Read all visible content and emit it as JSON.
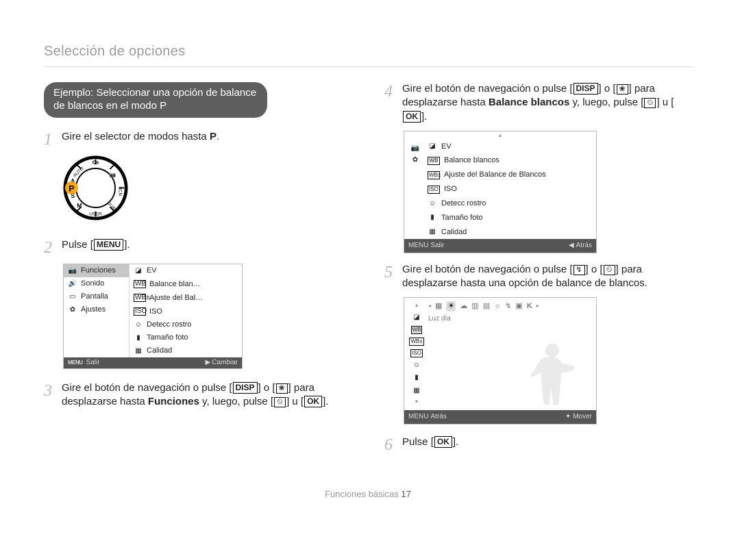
{
  "header": "Selección de opciones",
  "example_box": {
    "line1": "Ejemplo: Seleccionar una opción de balance",
    "line2": "de blancos en el modo P"
  },
  "steps": {
    "s1_num": "1",
    "s1_pre": "Gire el selector de modos hasta ",
    "s1_p": "P",
    "s1_post": ".",
    "s2_num": "2",
    "s2_pre": "Pulse [",
    "s2_btn": "MENU",
    "s2_post": "].",
    "s3_num": "3",
    "s3_a": "Gire el botón de navegación o pulse [",
    "s3_disp": "DISP",
    "s3_b": "] o [",
    "s3_flower": "❀",
    "s3_c": "] para desplazarse hasta ",
    "s3_bold": "Funciones",
    "s3_d": " y, luego, pulse [",
    "s3_timer": "⏲",
    "s3_e": "] u [",
    "s3_ok": "OK",
    "s3_f": "].",
    "s4_num": "4",
    "s4_a": "Gire el botón de navegación o pulse [",
    "s4_disp": "DISP",
    "s4_b": "] o [",
    "s4_flower": "❀",
    "s4_c": "] para desplazarse hasta ",
    "s4_bold": "Balance blancos",
    "s4_d": " y, luego, pulse [",
    "s4_timer": "⏲",
    "s4_e": "] u [",
    "s4_ok": "OK",
    "s4_f": "].",
    "s5_num": "5",
    "s5_a": "Gire el botón de navegación o pulse [",
    "s5_flash": "↯",
    "s5_b": "] o [",
    "s5_timer": "⏲",
    "s5_c": "] para desplazarse hasta una opción de balance de blancos.",
    "s6_num": "6",
    "s6_a": "Pulse [",
    "s6_ok": "OK",
    "s6_b": "]."
  },
  "menu_screen": {
    "left": {
      "funciones": "Funciones",
      "sonido": "Sonido",
      "pantalla": "Pantalla",
      "ajustes": "Ajustes"
    },
    "right": {
      "ev": "EV",
      "bb": "Balance blan…",
      "adj": "Ajuste del Bal…",
      "iso": "ISO",
      "face": "Detecc rostro",
      "size": "Tamaño foto",
      "quality": "Calidad"
    },
    "foot_left": "Salir",
    "foot_menu": "MENU",
    "foot_right": "Cambiar",
    "foot_arrow": "▶"
  },
  "bb_screen": {
    "ev": "EV",
    "bb": "Balance blancos",
    "adj": "Ajuste del Balance de Blancos",
    "iso": "ISO",
    "face": "Detecc rostro",
    "size": "Tamaño foto",
    "quality": "Calidad",
    "foot_left": "Salir",
    "foot_menu": "MENU",
    "foot_right": "Atrás",
    "foot_arrow": "◀"
  },
  "wb_screen": {
    "luz_dia": "Luz día",
    "k": "K",
    "foot_menu": "MENU",
    "foot_left": "Atrás",
    "foot_right": "Mover",
    "foot_diamond": "✦"
  },
  "footer": {
    "section": "Funciones básicas",
    "page": "17"
  }
}
